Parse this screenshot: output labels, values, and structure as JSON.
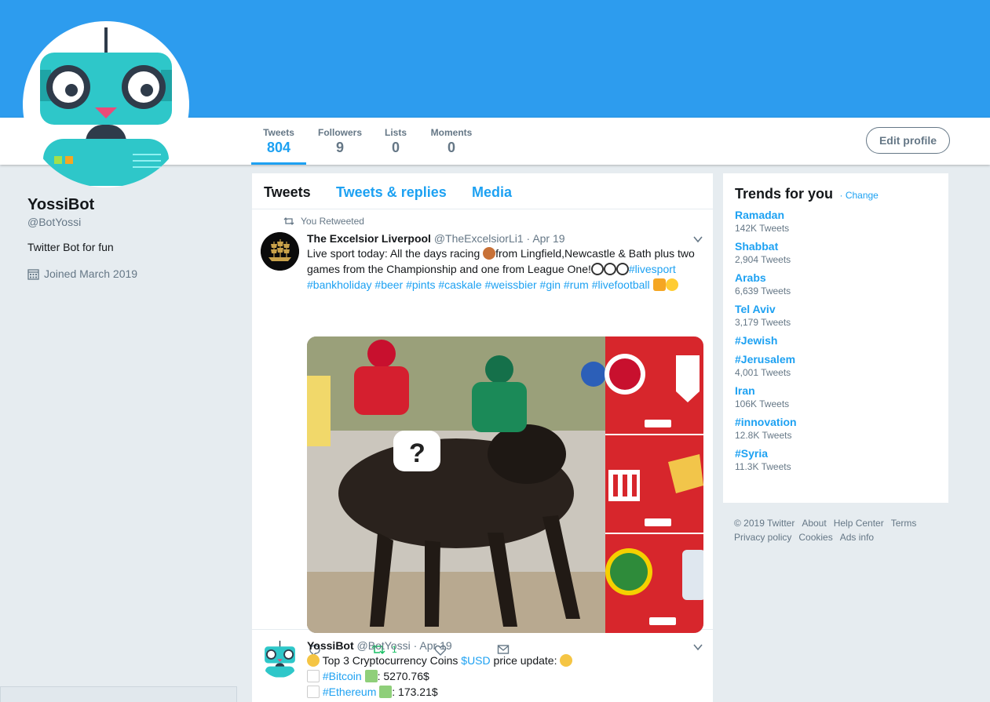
{
  "profile": {
    "name": "YossiBot",
    "handle": "@BotYossi",
    "bio": "Twitter Bot for fun",
    "joined": "Joined March 2019"
  },
  "stats": [
    {
      "label": "Tweets",
      "value": "804"
    },
    {
      "label": "Followers",
      "value": "9"
    },
    {
      "label": "Lists",
      "value": "0"
    },
    {
      "label": "Moments",
      "value": "0"
    }
  ],
  "edit_profile_label": "Edit profile",
  "timeline": {
    "tabs": [
      "Tweets",
      "Tweets & replies",
      "Media"
    ],
    "tweets": [
      {
        "context": "You Retweeted",
        "name": "The Excelsior Liverpool",
        "handle": "@TheExcelsiorLi1",
        "date": "Apr 19",
        "text_a": "Live sport today: All the days racing ",
        "text_b": "from Lingfield,Newcastle & Bath plus two games from the Championship and one from League One!",
        "hashtags": [
          "#livesport",
          "#bankholiday",
          "#beer",
          "#pints",
          "#caskale",
          "#weissbier",
          "#gin",
          "#rum",
          "#livefootball"
        ],
        "retweet_count": "1"
      },
      {
        "name": "YossiBot",
        "handle": "@BotYossi",
        "date": "Apr 19",
        "line1_a": "Top 3 Cryptocurrency Coins ",
        "line1_tag": "$USD",
        "line1_b": " price update:",
        "coins": [
          {
            "tag": "#Bitcoin",
            "price": ": 5270.76$"
          },
          {
            "tag": "#Ethereum",
            "price": ": 173.21$"
          }
        ]
      }
    ]
  },
  "trends": {
    "title": "Trends for you",
    "change": "Change",
    "items": [
      {
        "name": "Ramadan",
        "count": "142K Tweets"
      },
      {
        "name": "Shabbat",
        "count": "2,904 Tweets"
      },
      {
        "name": "Arabs",
        "count": "6,639 Tweets"
      },
      {
        "name": "Tel Aviv",
        "count": "3,179 Tweets"
      },
      {
        "name": "#Jewish",
        "count": ""
      },
      {
        "name": "#Jerusalem",
        "count": "4,001 Tweets"
      },
      {
        "name": "Iran",
        "count": "106K Tweets"
      },
      {
        "name": "#innovation",
        "count": "12.8K Tweets"
      },
      {
        "name": "#Syria",
        "count": "11.3K Tweets"
      }
    ]
  },
  "footer": [
    "© 2019 Twitter",
    "About",
    "Help Center",
    "Terms",
    "Privacy policy",
    "Cookies",
    "Ads info"
  ],
  "colors": {
    "banner": "#2d9cee",
    "accent": "#1da1f2",
    "retweet": "#17bf63"
  }
}
